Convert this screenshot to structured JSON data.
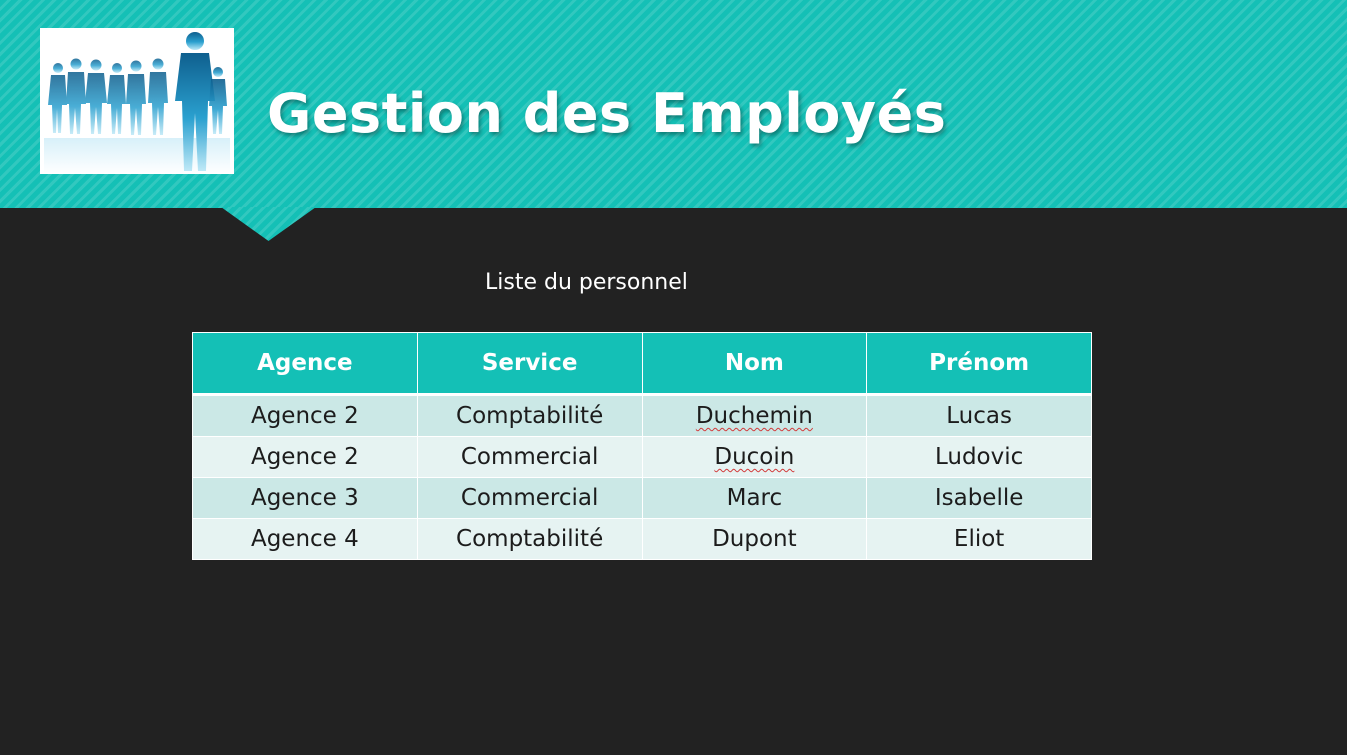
{
  "header": {
    "title": "Gestion des Employés",
    "accent_color": "#14c0b6",
    "logo_icon": "people-silhouettes-icon"
  },
  "subtitle": "Liste du personnel",
  "table": {
    "columns": [
      "Agence",
      "Service",
      "Nom",
      "Prénom"
    ],
    "rows": [
      [
        "Agence 2",
        "Comptabilité",
        "Duchemin",
        "Lucas"
      ],
      [
        "Agence 2",
        "Commercial",
        "Ducoin",
        "Ludovic"
      ],
      [
        "Agence 3",
        "Commercial",
        "Marc",
        "Isabelle"
      ],
      [
        "Agence 4",
        "Comptabilité",
        "Dupont",
        "Eliot"
      ]
    ]
  }
}
